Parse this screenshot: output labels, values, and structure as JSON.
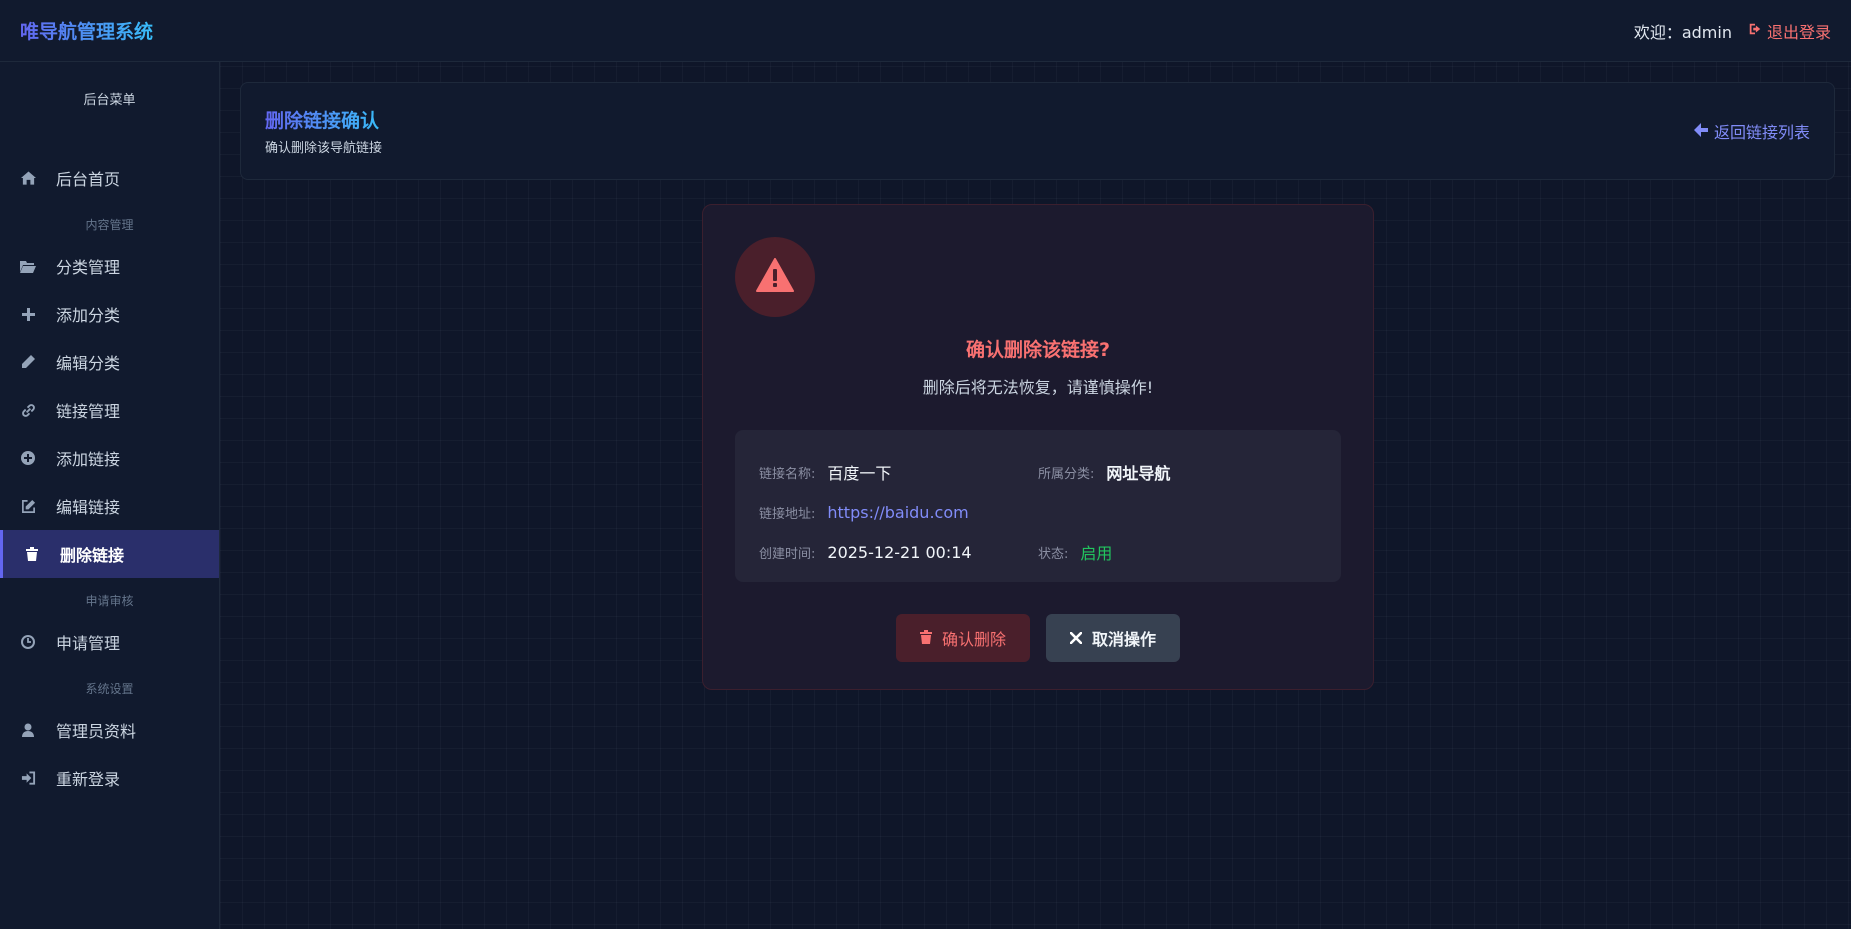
{
  "app": {
    "title": "唯导航管理系统",
    "welcome": "欢迎：admin",
    "logout": "退出登录"
  },
  "sidebar": {
    "title": "后台菜单",
    "home": "后台首页",
    "groups": {
      "content": "内容管理",
      "review": "申请审核",
      "system": "系统设置"
    },
    "items": {
      "category_manage": "分类管理",
      "add_category": "添加分类",
      "edit_category": "编辑分类",
      "link_manage": "链接管理",
      "add_link": "添加链接",
      "edit_link": "编辑链接",
      "delete_link": "删除链接",
      "apply_manage": "申请管理",
      "admin_profile": "管理员资料",
      "relogin": "重新登录"
    },
    "active": "delete_link"
  },
  "header": {
    "title": "删除链接确认",
    "subtitle": "确认删除该导航链接",
    "back": "返回链接列表"
  },
  "confirm": {
    "title": "确认删除该链接?",
    "subtitle": "删除后将无法恢复，请谨慎操作!",
    "fields": {
      "name_label": "链接名称:",
      "name_value": "百度一下",
      "category_label": "所属分类:",
      "category_value": "网址导航",
      "url_label": "链接地址:",
      "url_value": "https://baidu.com",
      "created_label": "创建时间:",
      "created_value": "2025-12-21 00:14",
      "status_label": "状态:",
      "status_value": "启用"
    },
    "confirm_button": "确认删除",
    "cancel_button": "取消操作"
  },
  "colors": {
    "accent": "#6366f1",
    "danger": "#f87171",
    "success": "#22c55e",
    "link": "#818cf8"
  }
}
